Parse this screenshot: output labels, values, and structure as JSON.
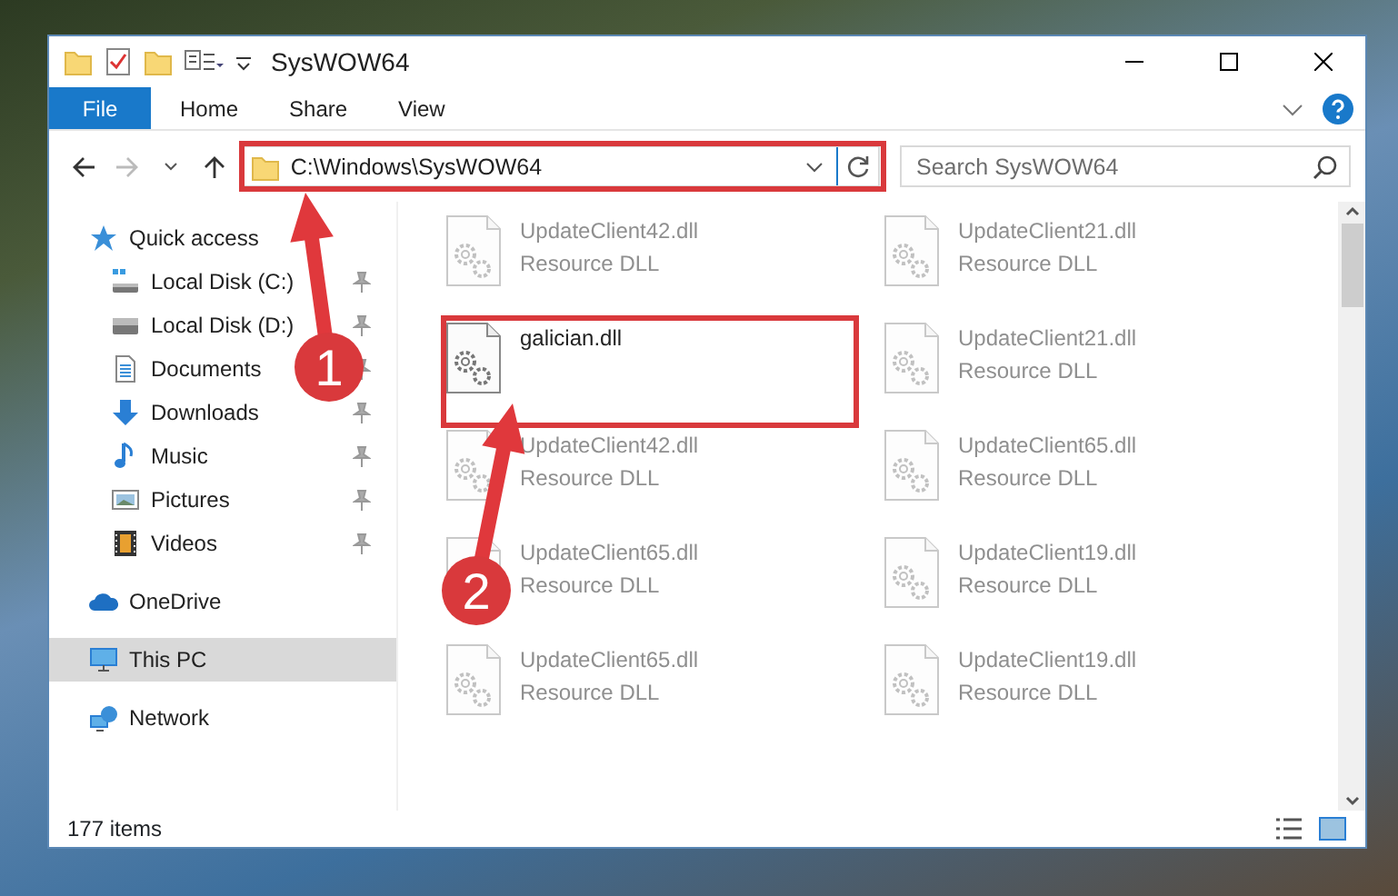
{
  "window": {
    "title": "SysWOW64"
  },
  "ribbon": {
    "file_tab": "File",
    "tabs": [
      {
        "label": "Home",
        "selected": false
      },
      {
        "label": "Share",
        "selected": false
      },
      {
        "label": "View",
        "selected": false
      }
    ]
  },
  "address_bar": {
    "path": "C:\\Windows\\SysWOW64"
  },
  "search": {
    "placeholder": "Search SysWOW64"
  },
  "sidebar": {
    "items": [
      {
        "label": "Quick access",
        "kind": "star",
        "selected": false,
        "children": [
          {
            "label": "Local Disk (C:)",
            "kind": "system-drive",
            "pinned": true
          },
          {
            "label": "Local Disk (D:)",
            "kind": "drive",
            "pinned": true
          },
          {
            "label": "Documents",
            "kind": "documents",
            "pinned": true
          },
          {
            "label": "Downloads",
            "kind": "downloads",
            "pinned": true
          },
          {
            "label": "Music",
            "kind": "music",
            "pinned": true
          },
          {
            "label": "Pictures",
            "kind": "pictures",
            "pinned": true
          },
          {
            "label": "Videos",
            "kind": "videos",
            "pinned": true
          }
        ]
      },
      {
        "label": "OneDrive",
        "kind": "cloud",
        "selected": false
      },
      {
        "label": "This PC",
        "kind": "computer",
        "selected": true
      },
      {
        "label": "Network",
        "kind": "network",
        "selected": false
      }
    ]
  },
  "files": [
    {
      "name": "UpdateClient42.dll",
      "type": "Resource DLL",
      "dimmed": true
    },
    {
      "name": "UpdateClient21.dll",
      "type": "Resource DLL",
      "dimmed": true
    },
    {
      "name": "galician.dll",
      "dimmed": false
    },
    {
      "name": "UpdateClient21.dll",
      "type": "Resource DLL",
      "dimmed": true
    },
    {
      "name": "UpdateClient42.dll",
      "type": "Resource DLL",
      "dimmed": true
    },
    {
      "name": "UpdateClient65.dll",
      "type": "Resource DLL",
      "dimmed": true
    },
    {
      "name": "UpdateClient65.dll",
      "type": "Resource DLL",
      "dimmed": true
    },
    {
      "name": "UpdateClient19.dll",
      "type": "Resource DLL",
      "dimmed": true
    },
    {
      "name": "UpdateClient65.dll",
      "type": "Resource DLL",
      "dimmed": true
    },
    {
      "name": "UpdateClient19.dll",
      "type": "Resource DLL",
      "dimmed": true
    }
  ],
  "status_bar": {
    "item_count": "177 items"
  },
  "annotations": [
    {
      "number": "1"
    },
    {
      "number": "2"
    }
  ]
}
